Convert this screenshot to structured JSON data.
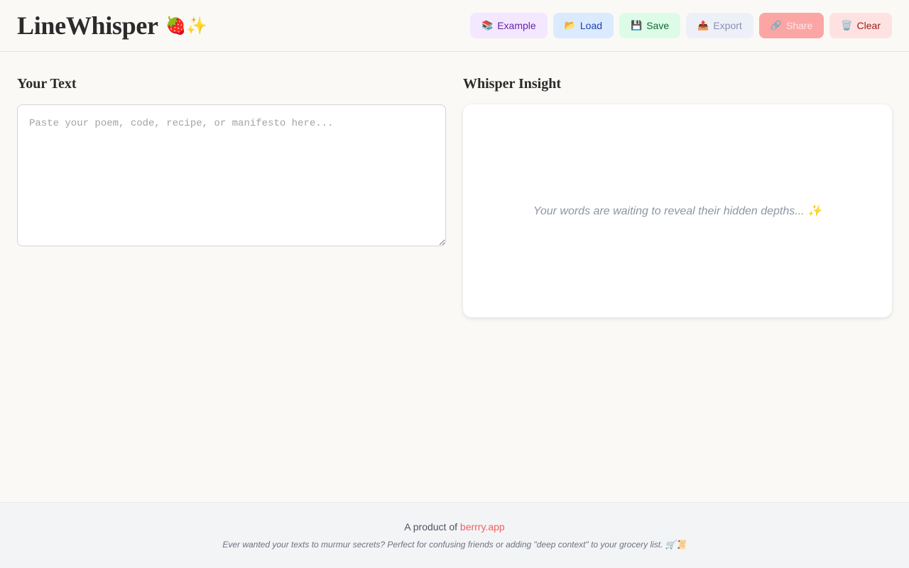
{
  "app": {
    "title": "LineWhisper",
    "title_emoji": "🍓✨"
  },
  "toolbar": {
    "example": {
      "icon": "📚",
      "label": "Example"
    },
    "load": {
      "icon": "📂",
      "label": "Load"
    },
    "save": {
      "icon": "💾",
      "label": "Save"
    },
    "export": {
      "icon": "📤",
      "label": "Export"
    },
    "share": {
      "icon": "🔗",
      "label": "Share"
    },
    "clear": {
      "icon": "🗑️",
      "label": "Clear"
    }
  },
  "input_panel": {
    "heading": "Your Text",
    "value": "",
    "placeholder": "Paste your poem, code, recipe, or manifesto here..."
  },
  "insight_panel": {
    "heading": "Whisper Insight",
    "empty_message": "Your words are waiting to reveal their hidden depths... ✨"
  },
  "footer": {
    "product_prefix": "A product of ",
    "product_link": "berrry.app",
    "tagline": "Ever wanted your texts to murmur secrets? Perfect for confusing friends or adding \"deep context\" to your grocery list. 🛒📜"
  },
  "colors": {
    "background": "#faf9f6",
    "example_bg": "#f3e8ff",
    "load_bg": "#dbeafe",
    "save_bg": "#dcfce7",
    "export_bg": "#eef0f8",
    "share_bg": "#fca5a5",
    "clear_bg": "#fee2e2",
    "link": "#f06060"
  }
}
